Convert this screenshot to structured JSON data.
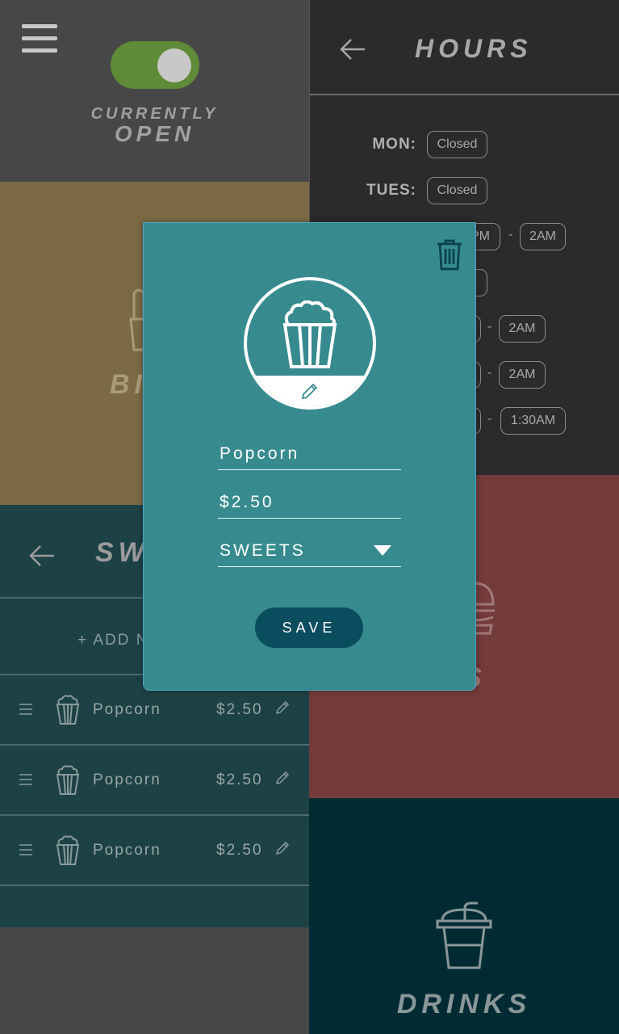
{
  "status": {
    "line1": "CURRENTLY",
    "line2": "OPEN",
    "toggle_on": true,
    "toggle_color": "#5f8a37"
  },
  "hours": {
    "title": "HOURS",
    "rows": [
      {
        "day": "MON:",
        "open": "Closed",
        "close": ""
      },
      {
        "day": "TUES:",
        "open": "Closed",
        "close": ""
      },
      {
        "day": "",
        "open": "PM",
        "close": "2AM"
      },
      {
        "day": "",
        "open": "",
        "close": ""
      },
      {
        "day": "",
        "open": "",
        "close": "2AM"
      },
      {
        "day": "",
        "open": "",
        "close": "2AM"
      },
      {
        "day": "",
        "open": "",
        "close": "1:30AM"
      }
    ]
  },
  "bites": {
    "label": "BI",
    "icon": "bites-icon"
  },
  "sweets": {
    "title": "SW",
    "add_label": "+ ADD N",
    "items": [
      {
        "name": "Popcorn",
        "price": "$2.50"
      },
      {
        "name": "Popcorn",
        "price": "$2.50"
      },
      {
        "name": "Popcorn",
        "price": "$2.50"
      }
    ]
  },
  "meals": {
    "label": "LS",
    "icon": "burger-icon"
  },
  "drinks": {
    "label": "DRINKS",
    "icon": "drink-cup-icon"
  },
  "modal": {
    "name": "Popcorn",
    "price": "$2.50",
    "category": "SWEETS",
    "save_label": "SAVE",
    "bg_color": "#378b8f",
    "button_color": "#0a4d5e"
  }
}
